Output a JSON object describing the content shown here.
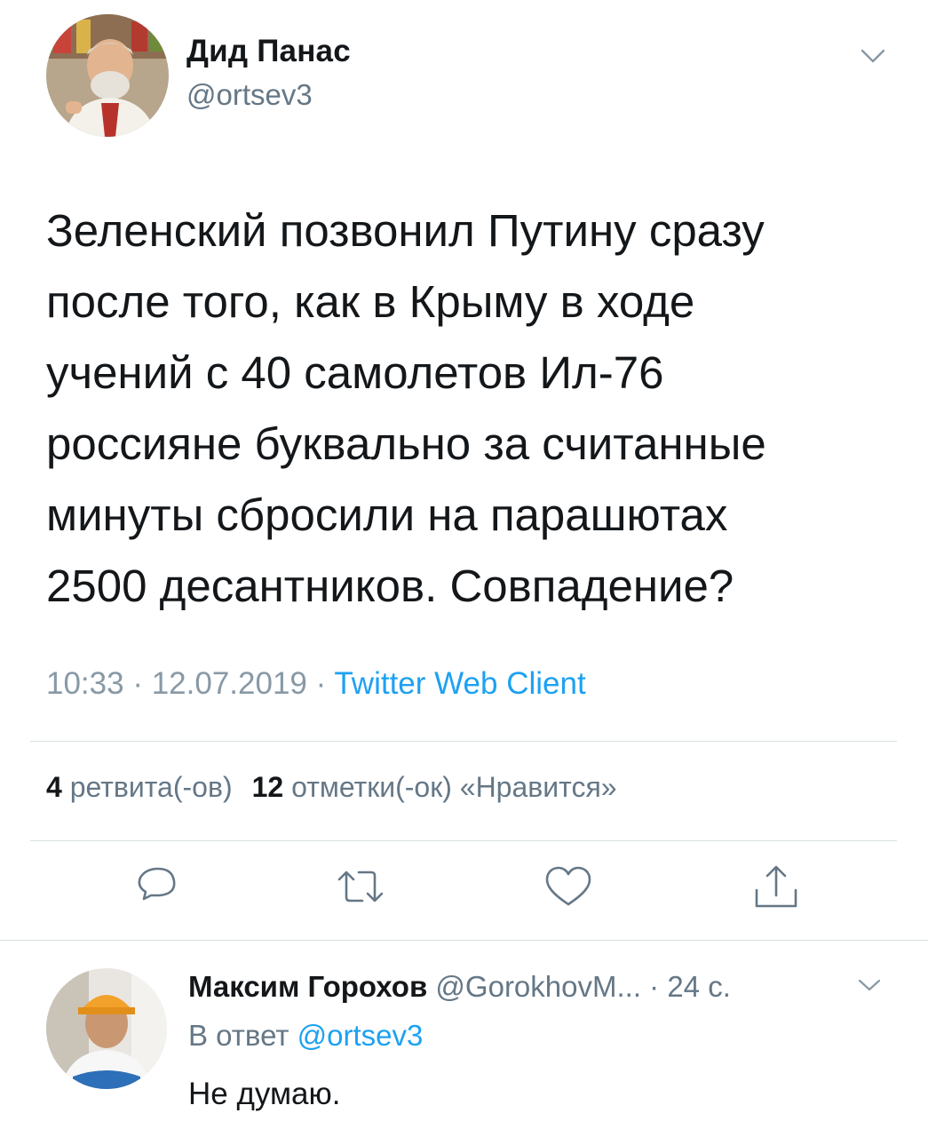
{
  "tweet": {
    "author_name": "Дид Панас",
    "author_handle": "@ortsev3",
    "text_lines": [
      "Зеленский позвонил Путину сразу",
      "после того, как в Крыму в ходе",
      "учений с 40 самолетов Ил-76",
      "россияне буквально за считанные",
      "минуты сбросили на парашютах",
      "2500 десантников. Совпадение?"
    ],
    "time": "10:33",
    "date": "12.07.2019",
    "separator": " · ",
    "client": "Twitter Web Client",
    "retweet_count": "4",
    "retweet_label": "ретвита(-ов)",
    "like_count": "12",
    "like_label": "отметки(-ок) «Нравится»",
    "icons": {
      "reply": "reply-icon",
      "retweet": "retweet-icon",
      "like": "heart-icon",
      "share": "share-icon",
      "menu": "chevron-down-icon"
    }
  },
  "reply": {
    "author_name": "Максим Горохов",
    "author_handle": "@GorokhovM...",
    "time_sep": " · ",
    "time_ago": "24 с.",
    "in_reply_prefix": "В ответ",
    "in_reply_mention": "@ortsev3",
    "text": "Не думаю."
  },
  "colors": {
    "text": "#14171a",
    "secondary": "#657786",
    "link": "#1da1f2",
    "divider": "#d9dfe3"
  }
}
